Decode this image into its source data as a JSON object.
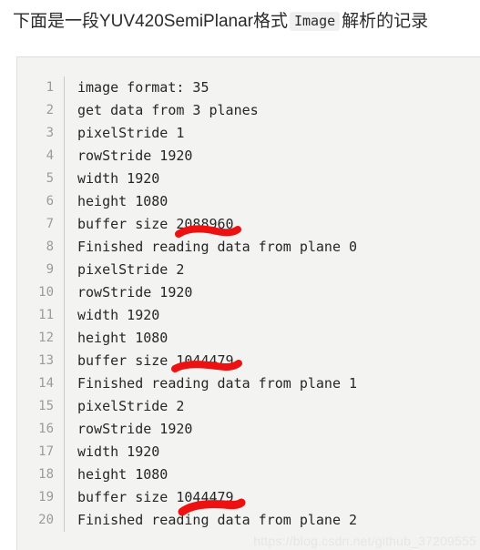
{
  "title": {
    "prefix": "下面是一段YUV420SemiPlanar格式",
    "code": "Image",
    "suffix": "解析的记录"
  },
  "code_block": {
    "language_hint": "log",
    "background_color": "#f3f3f1",
    "gutter_color": "#9b9b9b",
    "text_color": "#262626",
    "lines": [
      {
        "number": "1",
        "text": "image format: 35"
      },
      {
        "number": "2",
        "text": "get data from 3 planes"
      },
      {
        "number": "3",
        "text": "pixelStride 1"
      },
      {
        "number": "4",
        "text": "rowStride 1920"
      },
      {
        "number": "5",
        "text": "width 1920"
      },
      {
        "number": "6",
        "text": "height 1080"
      },
      {
        "number": "7",
        "text": "buffer size 2088960"
      },
      {
        "number": "8",
        "text": "Finished reading data from plane 0"
      },
      {
        "number": "9",
        "text": "pixelStride 2"
      },
      {
        "number": "10",
        "text": "rowStride 1920"
      },
      {
        "number": "11",
        "text": "width 1920"
      },
      {
        "number": "12",
        "text": "height 1080"
      },
      {
        "number": "13",
        "text": "buffer size 1044479"
      },
      {
        "number": "14",
        "text": "Finished reading data from plane 1"
      },
      {
        "number": "15",
        "text": "pixelStride 2"
      },
      {
        "number": "16",
        "text": "rowStride 1920"
      },
      {
        "number": "17",
        "text": "width 1920"
      },
      {
        "number": "18",
        "text": "height 1080"
      },
      {
        "number": "19",
        "text": "buffer size 1044479"
      },
      {
        "number": "20",
        "text": "Finished reading data from plane 2"
      }
    ]
  },
  "annotations": {
    "color": "#ee1111",
    "marks": [
      {
        "name": "underline-buffer-size-2088960",
        "target_value": "2088960",
        "target_line": "7"
      },
      {
        "name": "underline-buffer-size-1044479-plane1",
        "target_value": "1044479",
        "target_line": "13"
      },
      {
        "name": "underline-buffer-size-1044479-plane2",
        "target_value": "1044479",
        "target_line": "19"
      }
    ]
  },
  "watermark": {
    "text": "https://blog.csdn.net/github_37209555"
  }
}
